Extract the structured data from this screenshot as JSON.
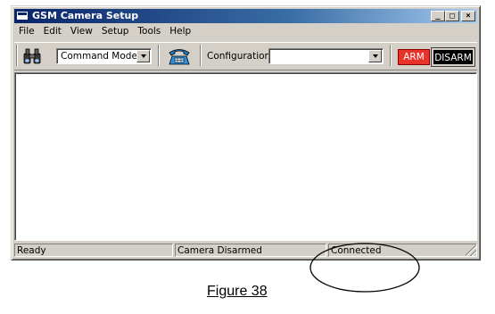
{
  "window": {
    "title": "GSM Camera Setup",
    "controls": {
      "minimize": "_",
      "maximize": "□",
      "close": "×"
    }
  },
  "menubar": [
    "File",
    "Edit",
    "View",
    "Setup",
    "Tools",
    "Help"
  ],
  "toolbar": {
    "binoculars_icon": "binoculars-icon",
    "mode_combo": {
      "value": "Command Mode"
    },
    "phone_icon": "telephone-icon",
    "configuration_label": "Configuration",
    "configuration_combo": {
      "value": ""
    },
    "arm_label": "ARM",
    "disarm_label": "DISARM"
  },
  "statusbar": {
    "ready": "Ready",
    "camera_state": "Camera Disarmed",
    "connection": "Connected"
  },
  "caption": "Figure 38",
  "colors": {
    "titlebar_start": "#0a246a",
    "arm_bg": "#e8332a",
    "disarm_bg": "#000000",
    "face": "#d4d0c8"
  }
}
